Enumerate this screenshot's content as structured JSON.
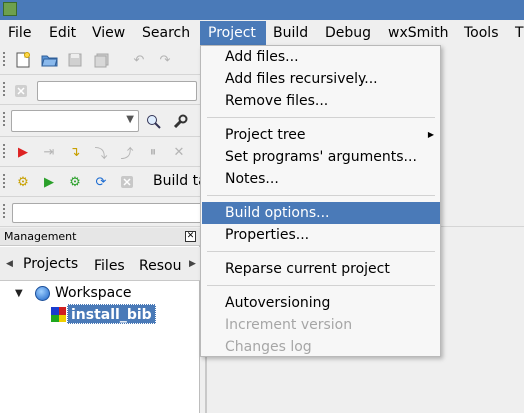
{
  "menubar": {
    "items": [
      {
        "label": "File"
      },
      {
        "label": "Edit"
      },
      {
        "label": "View"
      },
      {
        "label": "Search"
      },
      {
        "label": "Project"
      },
      {
        "label": "Build"
      },
      {
        "label": "Debug"
      },
      {
        "label": "wxSmith"
      },
      {
        "label": "Tools"
      },
      {
        "label": "T"
      }
    ],
    "active": "Project"
  },
  "toolbar": {
    "build_target_label": "Build ta"
  },
  "project_menu": {
    "items": [
      {
        "label": "Add files...",
        "enabled": true
      },
      {
        "label": "Add files recursively...",
        "enabled": true
      },
      {
        "label": "Remove files...",
        "enabled": true
      },
      {
        "label": "Project tree",
        "enabled": true,
        "has_submenu": true
      },
      {
        "label": "Set programs' arguments...",
        "enabled": true
      },
      {
        "label": "Notes...",
        "enabled": true
      },
      {
        "label": "Build options...",
        "enabled": true,
        "highlighted": true
      },
      {
        "label": "Properties...",
        "enabled": true
      },
      {
        "label": "Reparse current project",
        "enabled": true
      },
      {
        "label": "Autoversioning",
        "enabled": true
      },
      {
        "label": "Increment version",
        "enabled": false
      },
      {
        "label": "Changes log",
        "enabled": false
      }
    ]
  },
  "management": {
    "title": "Management",
    "tabs": [
      {
        "label": "Projects",
        "active": true
      },
      {
        "label": "Files"
      },
      {
        "label": "Resou"
      }
    ],
    "tree": {
      "workspace_label": "Workspace",
      "project_label": "install_bib"
    }
  },
  "colors": {
    "accent": "#4a7ab8",
    "menu_bg": "#f7f7f7",
    "disabled_text": "#a6a6a6"
  }
}
